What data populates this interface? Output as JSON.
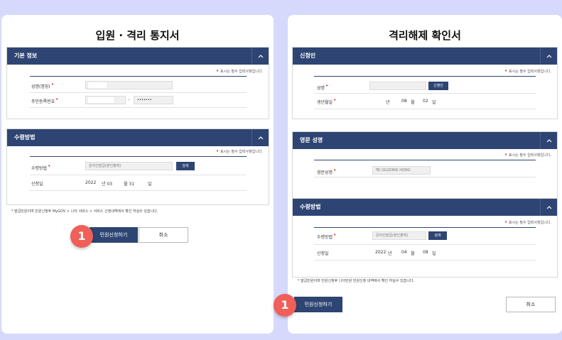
{
  "left": {
    "title": "입원 · 격리 통지서",
    "required_note": "표시는 필수 입력사항입니다.",
    "basic": {
      "header": "기본 정보",
      "name_label": "성명(명칭)",
      "rrn_label": "주민등록번호",
      "rrn_separator": "-",
      "rrn_back_masked": "•••••••"
    },
    "receive": {
      "header": "수령방법",
      "method_label": "수령방법",
      "method_value": "온라인발급(본인출력)",
      "search_label": "검색",
      "date_label": "신청일",
      "year": "2022",
      "year_unit": "년 03",
      "month_unit": "월 31",
      "day_unit": "일"
    },
    "footnote": "* 발급민원이며 민원신청후 MyGOV > 나의 서비스 > 서비스 신청내역에서 확인 하실수 있습니다.",
    "apply_label": "민원신청하기",
    "cancel_label": "취소",
    "badge_label": "1"
  },
  "right": {
    "title": "격리해제 확인서",
    "required_note": "표시는 필수 입력사항입니다.",
    "applicant": {
      "header": "신청인",
      "name_label": "성명",
      "applicant_btn": "신청인",
      "birth_label": "생년월일",
      "year_unit": "년",
      "month": "08",
      "month_unit": "월",
      "day": "02",
      "day_unit": "일"
    },
    "english": {
      "header": "영문 성명",
      "label": "영문성명",
      "placeholder": "예) GILDONG HONG"
    },
    "receive": {
      "header": "수령방법",
      "method_label": "수령방법",
      "method_value": "온라인발급(본인출력)",
      "search_label": "검색",
      "date_label": "신청일",
      "year": "2022",
      "year_unit": "년",
      "month": "04",
      "month_unit": "월",
      "day": "08",
      "day_unit": "일"
    },
    "footnote": "* 발급민원이며 민원신청후 나의민원 민원신청 내역에서 확인 하실수 있습니다.",
    "apply_label": "민원신청하기",
    "cancel_label": "취소",
    "badge_label": "1"
  },
  "colors": {
    "background": "#d6d9fb",
    "header_navy": "#2e4573",
    "badge_red": "#f05f58",
    "required_star": "#e02020"
  }
}
